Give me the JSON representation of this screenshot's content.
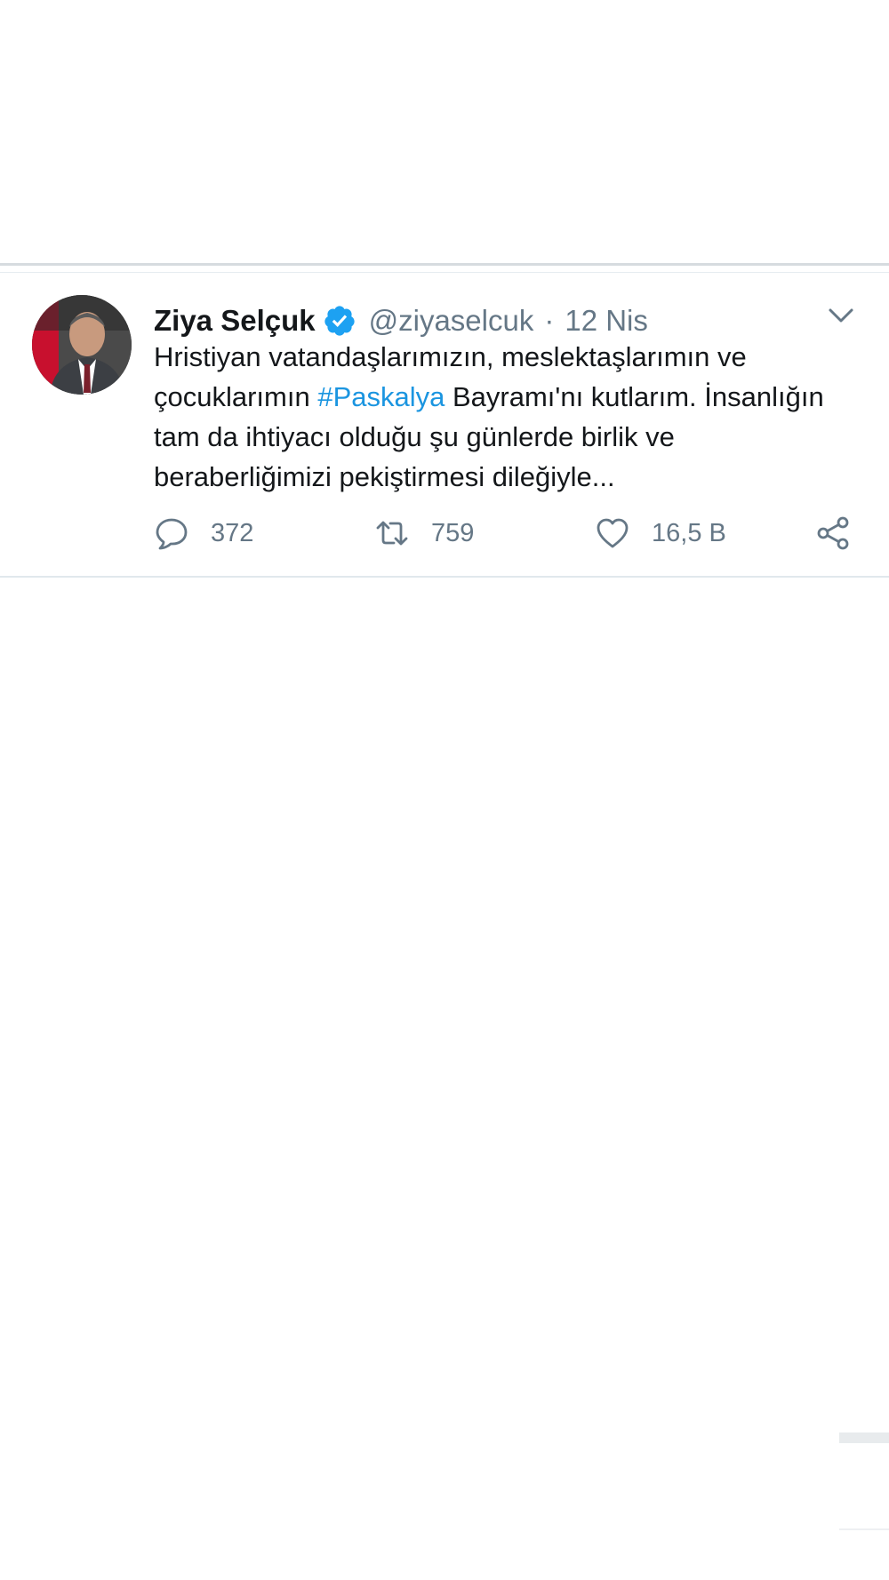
{
  "tweet": {
    "author": {
      "display_name": "Ziya Selçuk",
      "handle": "@ziyaselcuk",
      "verified": true
    },
    "separator": "·",
    "date": "12 Nis",
    "text": {
      "part1": "Hristiyan vatandaşlarımızın, meslektaşlarımın ve çocuklarımın ",
      "hashtag": "#Paskalya",
      "part2": " Bayramı'nı kutlarım. İnsanlığın tam da ihtiyacı olduğu şu günlerde birlik ve beraberliğimizi pekiştirmesi dileğiyle..."
    },
    "actions": {
      "reply": {
        "icon": "reply-icon",
        "count": "372"
      },
      "retweet": {
        "icon": "retweet-icon",
        "count": "759"
      },
      "like": {
        "icon": "heart-icon",
        "count": "16,5 B"
      },
      "share": {
        "icon": "share-icon"
      }
    },
    "menu_icon": "chevron-down-icon"
  },
  "colors": {
    "text": "#14171a",
    "secondary": "#657786",
    "link": "#1b95e0",
    "verified": "#1da1f2",
    "divider": "#e1e8ed"
  }
}
